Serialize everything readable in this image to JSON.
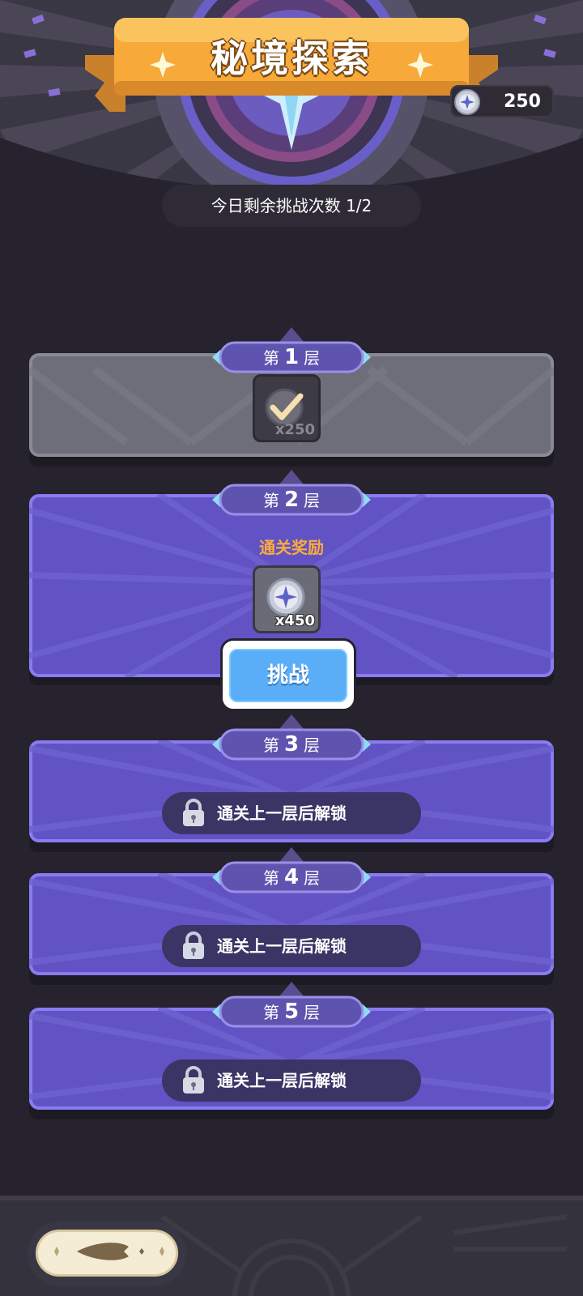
{
  "header": {
    "title": "秘境探索",
    "currency_value": "250",
    "attempts_text": "今日剩余挑战次数 1/2"
  },
  "floors": [
    {
      "prefix": "第",
      "number": "1",
      "suffix": "层",
      "state": "completed",
      "reward_count": "x250"
    },
    {
      "prefix": "第",
      "number": "2",
      "suffix": "层",
      "state": "current",
      "reward_label": "通关奖励",
      "reward_count": "x450",
      "button_label": "挑战"
    },
    {
      "prefix": "第",
      "number": "3",
      "suffix": "层",
      "state": "locked",
      "lock_text": "通关上一层后解锁"
    },
    {
      "prefix": "第",
      "number": "4",
      "suffix": "层",
      "state": "locked",
      "lock_text": "通关上一层后解锁"
    },
    {
      "prefix": "第",
      "number": "5",
      "suffix": "层",
      "state": "locked",
      "lock_text": "通关上一层后解锁"
    }
  ],
  "icons": {
    "currency": "star-coin-icon",
    "completed": "checkmark-coin-icon",
    "reward": "star-coin-icon",
    "locked": "padlock-icon",
    "back": "back-arrow-icon"
  },
  "colors": {
    "background": "#26232e",
    "panel_active": "#6b5fd6",
    "panel_completed": "#6b6b78",
    "banner": "#f7a93a",
    "reward_label": "#ffab3a",
    "button": "#5aaef8"
  }
}
